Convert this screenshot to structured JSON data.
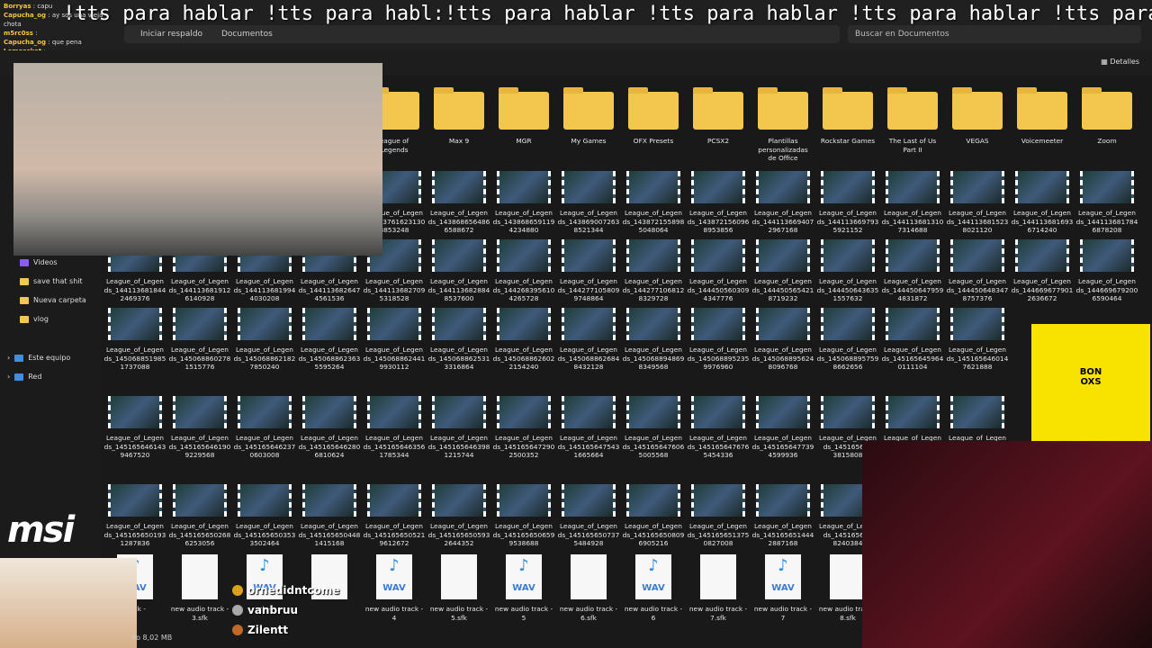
{
  "marquee": "!tts para hablar !tts para habl:!tts para hablar !tts para hablar !tts para hablar !tts para",
  "chat": [
    {
      "user": "Borryas",
      "msg": "capu"
    },
    {
      "user": "Capucha_og",
      "msg": "ay sos una vieja chota"
    },
    {
      "user": "m5rc0ss",
      "msg": ""
    },
    {
      "user": "Capucha_og",
      "msg": "que pena"
    },
    {
      "user": "Lemossket",
      "msg": ""
    }
  ],
  "address": {
    "part1": "Iniciar respaldo",
    "part2": "Documentos"
  },
  "search": {
    "placeholder": "Buscar en Documentos"
  },
  "toolbar": {
    "details": "Detalles"
  },
  "sidebar": [
    {
      "label": "Videos"
    },
    {
      "label": "save that shit"
    },
    {
      "label": "Nueva carpeta"
    },
    {
      "label": "vlog"
    },
    {
      "label": "Este equipo"
    },
    {
      "label": "Red"
    }
  ],
  "folders": [
    "eague of\nLegends",
    "Max 9",
    "MGR",
    "My Games",
    "OFX Presets",
    "PCSX2",
    "Plantillas\npersonalizadas\nde Office",
    "Rockstar Games",
    "The Last of Us\nPart II",
    "VEGAS",
    "Voicemeeter",
    "Zoom"
  ],
  "row2": [
    "League_of_Legen\nds_143761623130\n8853248",
    "League_of_Legen\nds_143868656486\n6588672",
    "League_of_Legen\nds_143868659119\n4234880",
    "League_of_Legen\nds_143869007263\n8521344",
    "League_of_Legen\nds_143872155898\n5048064",
    "League_of_Legen\nds_143872156096\n8953856",
    "League_of_Legen\nds_144113669407\n2967168",
    "League_of_Legen\nds_144113669793\n5921152",
    "League_of_Legen\nds_144113681310\n7314688",
    "League_of_Legen\nds_144113681523\n8021120",
    "League_of_Legen\nds_144113681693\n6714240",
    "League_of_Legen\nds_144113681784\n6878208"
  ],
  "row3": [
    "League_of_Legen\nds_144113681844\n2469376",
    "League_of_Legen\nds_144113681912\n6140928",
    "League_of_Legen\nds_144113681994\n4030208",
    "League_of_Legen\nds_144113682647\n4561536",
    "League_of_Legen\nds_144113682709\n5318528",
    "League_of_Legen\nds_144113682884\n8537600",
    "League_of_Legen\nds_144268395610\n4265728",
    "League_of_Legen\nds_144277105809\n9748864",
    "League_of_Legen\nds_144277106812\n8329728",
    "League_of_Legen\nds_144450560309\n4347776",
    "League_of_Legen\nds_144450565421\n8719232",
    "League_of_Legen\nds_144450643635\n1557632",
    "League_of_Legen\nds_144450647959\n4831872",
    "League_of_Legen\nds_144450648347\n8757376",
    "League_of_Legen\nds_144669677901\n2636672",
    "League_of_Legen\nds_144669679200\n6590464"
  ],
  "row4": [
    "League_of_Legen\nds_145068851985\n1737088",
    "League_of_Legen\nds_145068860278\n1515776",
    "League_of_Legen\nds_145068862182\n7850240",
    "League_of_Legen\nds_145068862363\n5595264",
    "League_of_Legen\nds_145068862441\n9930112",
    "League_of_Legen\nds_145068862531\n3316864",
    "League_of_Legen\nds_145068862602\n2154240",
    "League_of_Legen\nds_145068862684\n8432128",
    "League_of_Legen\nds_145068894869\n8349568",
    "League_of_Legen\nds_145068895235\n9976960",
    "League_of_Legen\nds_145068895624\n8096768",
    "League_of_Legen\nds_145068895759\n8662656",
    "League_of_Legen\nds_145165645964\n0111104",
    "League_of_Legen\nds_145165646014\n7621888"
  ],
  "row5": [
    "League_of_Legen\nds_145165646143\n9467520",
    "League_of_Legen\nds_145165646190\n9229568",
    "League_of_Legen\nds_145165646237\n0603008",
    "League_of_Legen\nds_145165646280\n6810624",
    "League_of_Legen\nds_145165646356\n1785344",
    "League_of_Legen\nds_145165646398\n1215744",
    "League_of_Legen\nds_145165647290\n2500352",
    "League_of_Legen\nds_145165647543\n1665664",
    "League_of_Legen\nds_145165647606\n5005568",
    "League_of_Legen\nds_145165647676\n5454336",
    "League_of_Legen\nds_145165647739\n4599936",
    "League_of_Legen\nds_145165647\n3815808",
    "League_of_Legen",
    "League_of_Legen"
  ],
  "row6": [
    "League_of_Legen\nds_145165650193\n1287836",
    "League_of_Legen\nds_145165650268\n6253056",
    "League_of_Legen\nds_145165650353\n3502464",
    "League_of_Legen\nds_145165650448\n1415168",
    "League_of_Legen\nds_145165650521\n9612672",
    "League_of_Legen\nds_145165650593\n2644352",
    "League_of_Legen\nds_145165650659\n9538688",
    "League_of_Legen\nds_145165650737\n5484928",
    "League_of_Legen\nds_145165650809\n6905216",
    "League_of_Legen\nds_145165651375\n0827008",
    "League_of_Legen\nds_145165651444\n2887168",
    "League_of_Legen\nds_145165651\n8240384"
  ],
  "row7": [
    {
      "label": "track -",
      "wav": true
    },
    {
      "label": "new audio track -\n3.sfk",
      "wav": false
    },
    {
      "label": "ck -",
      "wav": true
    },
    {
      "label": "",
      "wav": false
    },
    {
      "label": "new audio track -\n4",
      "wav": true
    },
    {
      "label": "new audio track -\n5.sfk",
      "wav": false
    },
    {
      "label": "new audio track -\n5",
      "wav": true
    },
    {
      "label": "new audio track -\n6.sfk",
      "wav": false
    },
    {
      "label": "new audio track -\n6",
      "wav": true
    },
    {
      "label": "new audio track -\n7.sfk",
      "wav": false
    },
    {
      "label": "new audio track -\n7",
      "wav": true
    },
    {
      "label": "new audio track -\n8.sfk",
      "wav": false
    }
  ],
  "wav_label": "WAV",
  "qr_text": "BON\nOXS",
  "msi": "msi",
  "badges": [
    "ornedidntcome",
    "vanbruu",
    "Zilentt"
  ],
  "status": "do 8,02 MB"
}
